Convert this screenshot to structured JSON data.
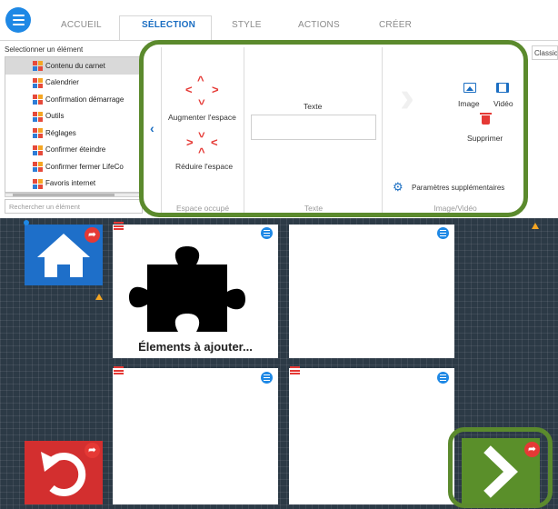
{
  "tabs": [
    {
      "label": "ACCUEIL"
    },
    {
      "label": "SÉLECTION"
    },
    {
      "label": "STYLE"
    },
    {
      "label": "ACTIONS"
    },
    {
      "label": "CRÉER"
    }
  ],
  "active_tab": "SÉLECTION",
  "element_list": {
    "title": "Selectionner un élément",
    "items": [
      {
        "label": "Contenu du carnet",
        "selected": true
      },
      {
        "label": "Calendrier",
        "selected": false
      },
      {
        "label": "Confirmation démarrage",
        "selected": false
      },
      {
        "label": "Outils",
        "selected": false
      },
      {
        "label": "Réglages",
        "selected": false
      },
      {
        "label": "Confirmer éteindre",
        "selected": false
      },
      {
        "label": "Confirmer fermer LifeCo",
        "selected": false
      },
      {
        "label": "Favoris internet",
        "selected": false
      }
    ],
    "search_placeholder": "Rechercher un élément"
  },
  "ribbon": {
    "augmenter_label": "Augmenter l'espace",
    "reduire_label": "Réduire l'espace",
    "espace_group_label": "Espace occupé",
    "texte_label": "Texte",
    "texte_value": "",
    "texte_group_label": "Texte",
    "image_label": "Image",
    "video_label": "Vidéo",
    "supprimer_label": "Supprimer",
    "params_label": "Paramètres supplémentaires",
    "media_group_label": "Image/Vidéo",
    "style_dropdown": "Classic"
  },
  "board": {
    "puzzle_caption": "Élements à ajouter..."
  },
  "colors": {
    "accent_blue": "#1e88e5",
    "highlight_green": "#5b8a2d",
    "home_tile": "#1e6fc9",
    "back_tile": "#d32f2f",
    "next_tile": "#5a8f2a",
    "board_bg": "#2c3a46"
  },
  "icons": {
    "menu": "hamburger-icon",
    "home": "house-icon",
    "back": "undo-arrow-icon",
    "next": "chevron-right-icon",
    "puzzle": "puzzle-piece-icon",
    "image": "image-icon",
    "video": "video-icon",
    "delete": "trash-icon",
    "settings": "gears-icon"
  }
}
